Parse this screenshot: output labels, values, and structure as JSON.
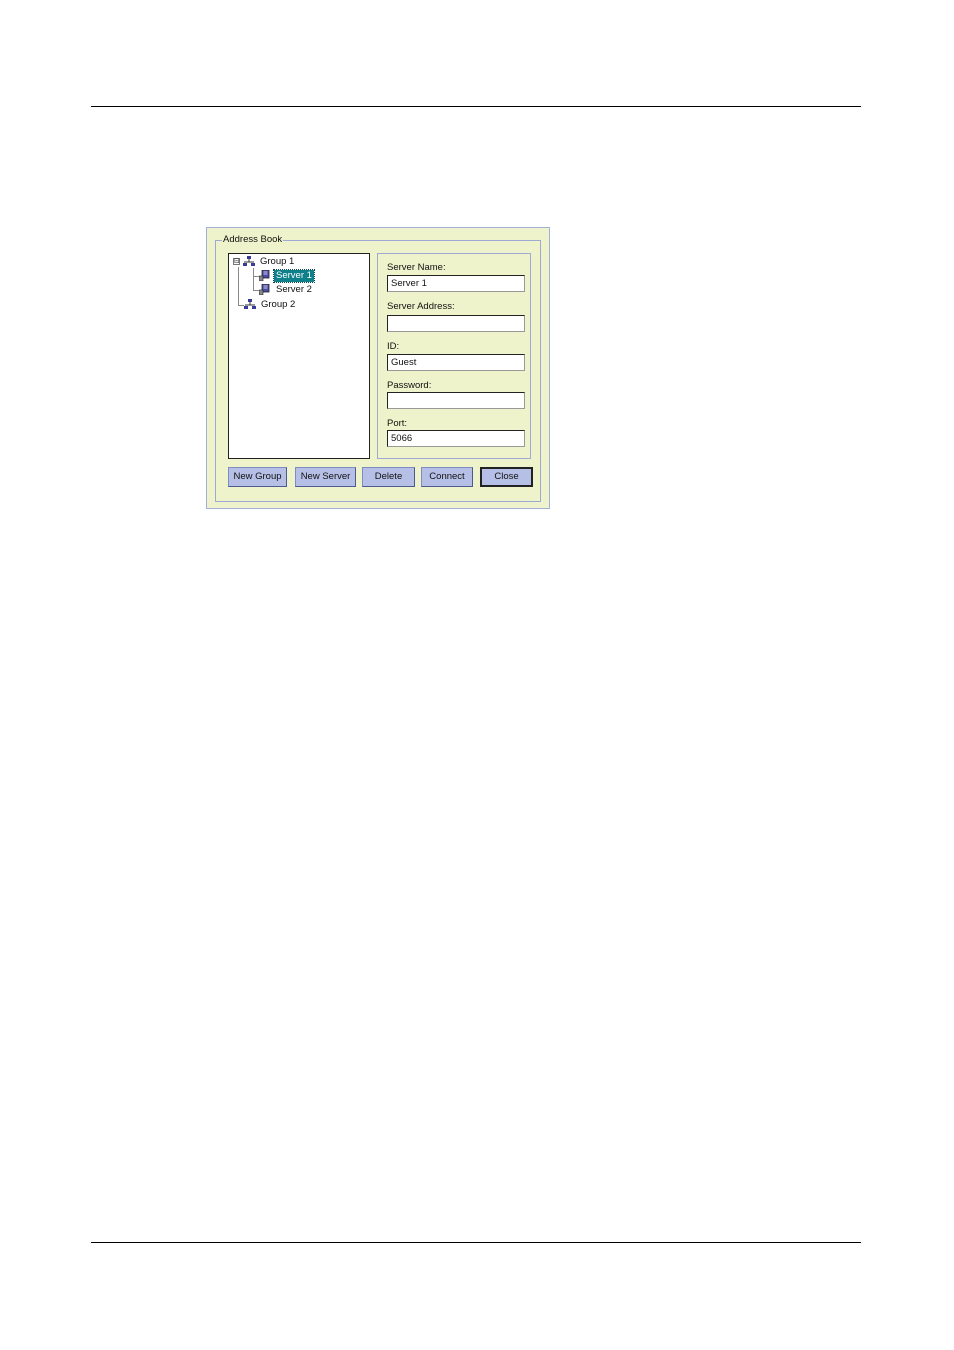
{
  "dialog": {
    "title": "Address Book",
    "tree": {
      "groups": [
        {
          "label": "Group 1",
          "expander": "⊟",
          "servers": [
            {
              "label": "Server 1",
              "selected": true
            },
            {
              "label": "Server 2",
              "selected": false
            }
          ]
        },
        {
          "label": "Group 2",
          "servers": []
        }
      ]
    },
    "fields": {
      "server_name": {
        "label": "Server Name:",
        "value": "Server 1"
      },
      "server_address": {
        "label": "Server Address:",
        "value": ""
      },
      "id": {
        "label": "ID:",
        "value": "Guest"
      },
      "password": {
        "label": "Password:",
        "value": ""
      },
      "port": {
        "label": "Port:",
        "value": "5066"
      }
    },
    "buttons": {
      "new_group": "New Group",
      "new_server": "New Server",
      "delete": "Delete",
      "connect": "Connect",
      "close": "Close"
    }
  },
  "colors": {
    "dialog_background": "#eef3cb",
    "button_face": "#b6c0e6",
    "selection": "#0f7f8a"
  }
}
